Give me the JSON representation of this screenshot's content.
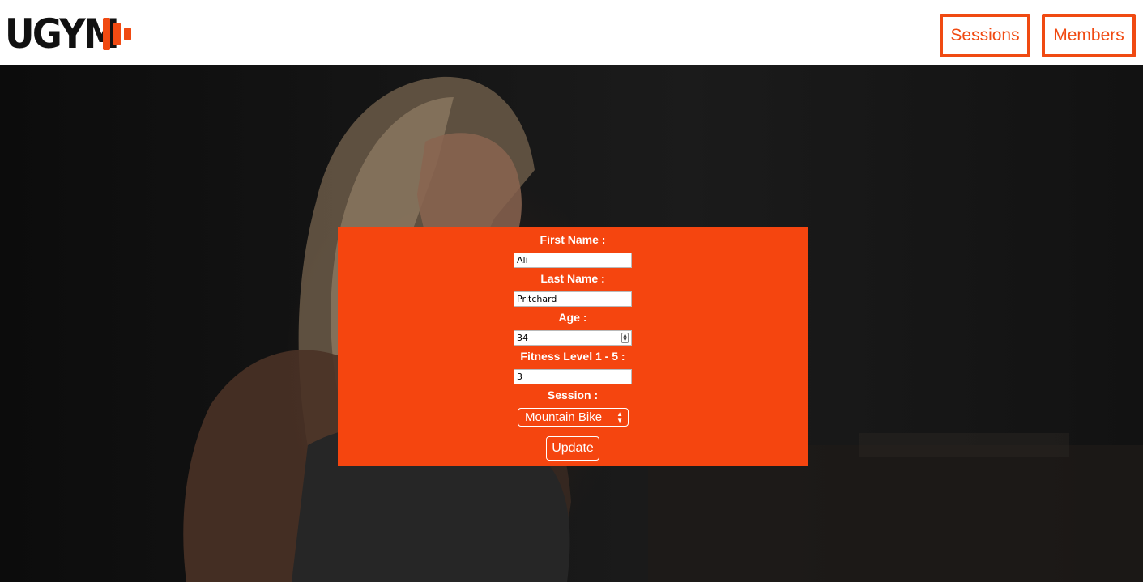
{
  "brand": {
    "logo_text": "UGYM",
    "accent_color": "#f04a12"
  },
  "nav": {
    "sessions_label": "Sessions",
    "members_label": "Members"
  },
  "form": {
    "panel_color": "#f5450f",
    "first_name": {
      "label": "First Name :",
      "value": "Ali"
    },
    "last_name": {
      "label": "Last Name :",
      "value": "Pritchard"
    },
    "age": {
      "label": "Age :",
      "value": "34"
    },
    "fitness_level": {
      "label": "Fitness Level 1 - 5 :",
      "value": "3"
    },
    "session": {
      "label": "Session :",
      "selected": "Mountain Bike"
    },
    "submit_label": "Update"
  },
  "hero_image": {
    "icon": "woman-athlete-photo"
  }
}
